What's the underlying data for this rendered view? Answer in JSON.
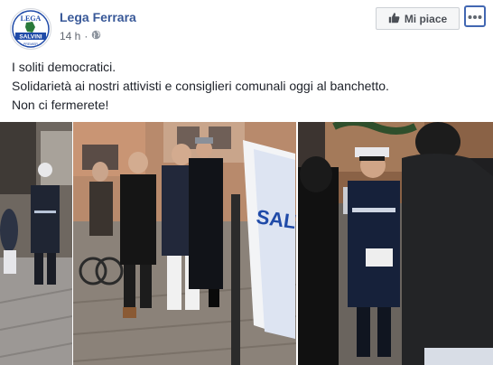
{
  "page": {
    "name": "Lega Ferrara",
    "time": "14 h",
    "audience_icon": "globe-icon"
  },
  "avatar": {
    "logo_top_text": "LEGA",
    "logo_banner_text": "SALVINI",
    "logo_bottom_text": "PREMIER"
  },
  "actions": {
    "like_label": "Mi piace",
    "like_icon": "thumbs-up-icon",
    "more_icon": "more-options-icon"
  },
  "post": {
    "lines": [
      "I soliti democratici.",
      "Solidarietà ai nostri attivisti e consiglieri comunali oggi al banchetto.",
      "Non ci fermerete!"
    ]
  },
  "photos": {
    "flag_text": "SALV"
  },
  "colors": {
    "brand_link": "#385898",
    "accent": "#4267b2",
    "meta": "#616770"
  }
}
